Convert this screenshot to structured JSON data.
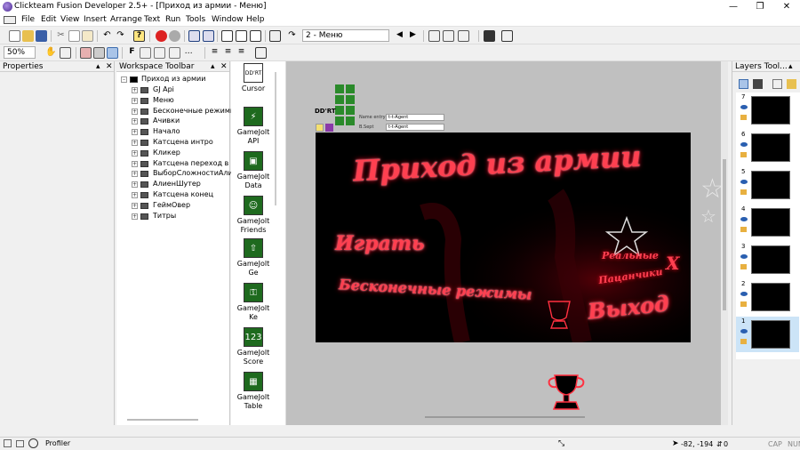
{
  "window": {
    "title": "Clickteam Fusion Developer 2.5+ - [Приход из армии - Меню]"
  },
  "menu": [
    "File",
    "Edit",
    "View",
    "Insert",
    "Arrange",
    "Text",
    "Run",
    "Tools",
    "Window",
    "Help"
  ],
  "toolbar": {
    "frame_combo": "2 - Меню",
    "zoom_combo": "50%"
  },
  "panels": {
    "properties_title": "Properties",
    "workspace_title": "Workspace Toolbar",
    "layers_title": "Layers Tool..."
  },
  "tree": {
    "root": "Приход из армии",
    "items": [
      "GJ Api",
      "Меню",
      "Бесконечные режимы",
      "Ачивки",
      "Начало",
      "Катсцена интро",
      "Кликер",
      "Катсцена переход в али",
      "ВыборСложностиАлие",
      "АлиенШутер",
      "Катсцена конец",
      "ГеймОвер",
      "Титры"
    ]
  },
  "objects": [
    {
      "label": "Cursor",
      "icon": "cursor-icon"
    },
    {
      "label": "GameJolt API",
      "icon": "gamejolt-api-icon"
    },
    {
      "label": "GameJolt Data",
      "icon": "gamejolt-data-icon"
    },
    {
      "label": "GameJolt Friends",
      "icon": "gamejolt-friends-icon"
    },
    {
      "label": "GameJolt Ge",
      "icon": "gamejolt-ge-icon"
    },
    {
      "label": "GameJolt Ke",
      "icon": "gamejolt-key-icon"
    },
    {
      "label": "GameJolt Score",
      "icon": "gamejolt-score-icon"
    },
    {
      "label": "GameJolt Table",
      "icon": "gamejolt-table-icon"
    }
  ],
  "frame": {
    "title_text": "Приход из армии",
    "play_text": "Играть",
    "endless_text": "Бесконечные режимы",
    "real_text_1": "Реальные",
    "real_text_2": "Пацанчики",
    "exit_text": "Выход",
    "x_text": "X",
    "field1_label": "Name entry",
    "field1_value": "t-t-Agent",
    "field2_label": "B.Sept",
    "field2_value": "t-t-Agent",
    "ddrt_text": "DD'RT"
  },
  "layers": [
    {
      "num": "7"
    },
    {
      "num": "6"
    },
    {
      "num": "5"
    },
    {
      "num": "4"
    },
    {
      "num": "3"
    },
    {
      "num": "2"
    },
    {
      "num": "1"
    }
  ],
  "status": {
    "profiler": "Profiler",
    "coords": "-82, -194",
    "sel_count": "0",
    "caps": "CAP",
    "num": "NUM"
  },
  "colors": {
    "neon": "#ff3040",
    "selected_layer": "#cce4f7",
    "canvas_bg": "#c0c0c0"
  }
}
